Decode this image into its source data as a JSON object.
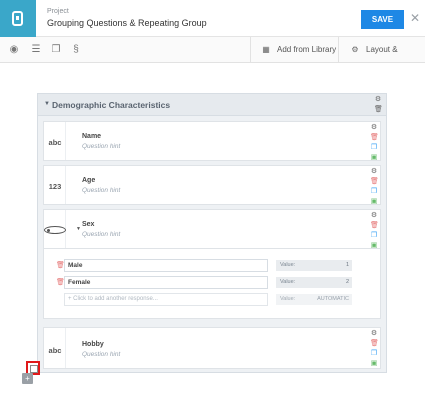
{
  "header": {
    "project_label": "Project",
    "project_name": "Grouping Questions & Repeating Group",
    "save_label": "SAVE",
    "close_icon": "close-icon"
  },
  "toolbar": {
    "icons": [
      "eye-icon",
      "list-icon",
      "copy-icon",
      "format-icon"
    ],
    "add_from_library": "Add from Library",
    "layout_settings": "Layout & Settings"
  },
  "group": {
    "title": "Demographic Characteristics"
  },
  "questions": [
    {
      "type_label": "abc",
      "name": "Name",
      "hint": "Question hint"
    },
    {
      "type_label": "123",
      "name": "Age",
      "hint": "Question hint"
    },
    {
      "type_label": "",
      "name": "Sex",
      "hint": "Question hint"
    },
    {
      "type_label": "abc",
      "name": "Hobby",
      "hint": "Question hint"
    }
  ],
  "responses": {
    "items": [
      {
        "label": "Male",
        "value_label": "Value:",
        "value": "1"
      },
      {
        "label": "Female",
        "value_label": "Value:",
        "value": "2"
      }
    ],
    "add_placeholder": "+ Click to add another response...",
    "auto_value_label": "Value:",
    "auto_value": "AUTOMATIC"
  },
  "colors": {
    "accent": "#3aa7c9",
    "save": "#1e88e5",
    "delete": "#e57373",
    "copy": "#42a5f5",
    "move": "#66bb6a",
    "highlight": "#e0191a"
  }
}
